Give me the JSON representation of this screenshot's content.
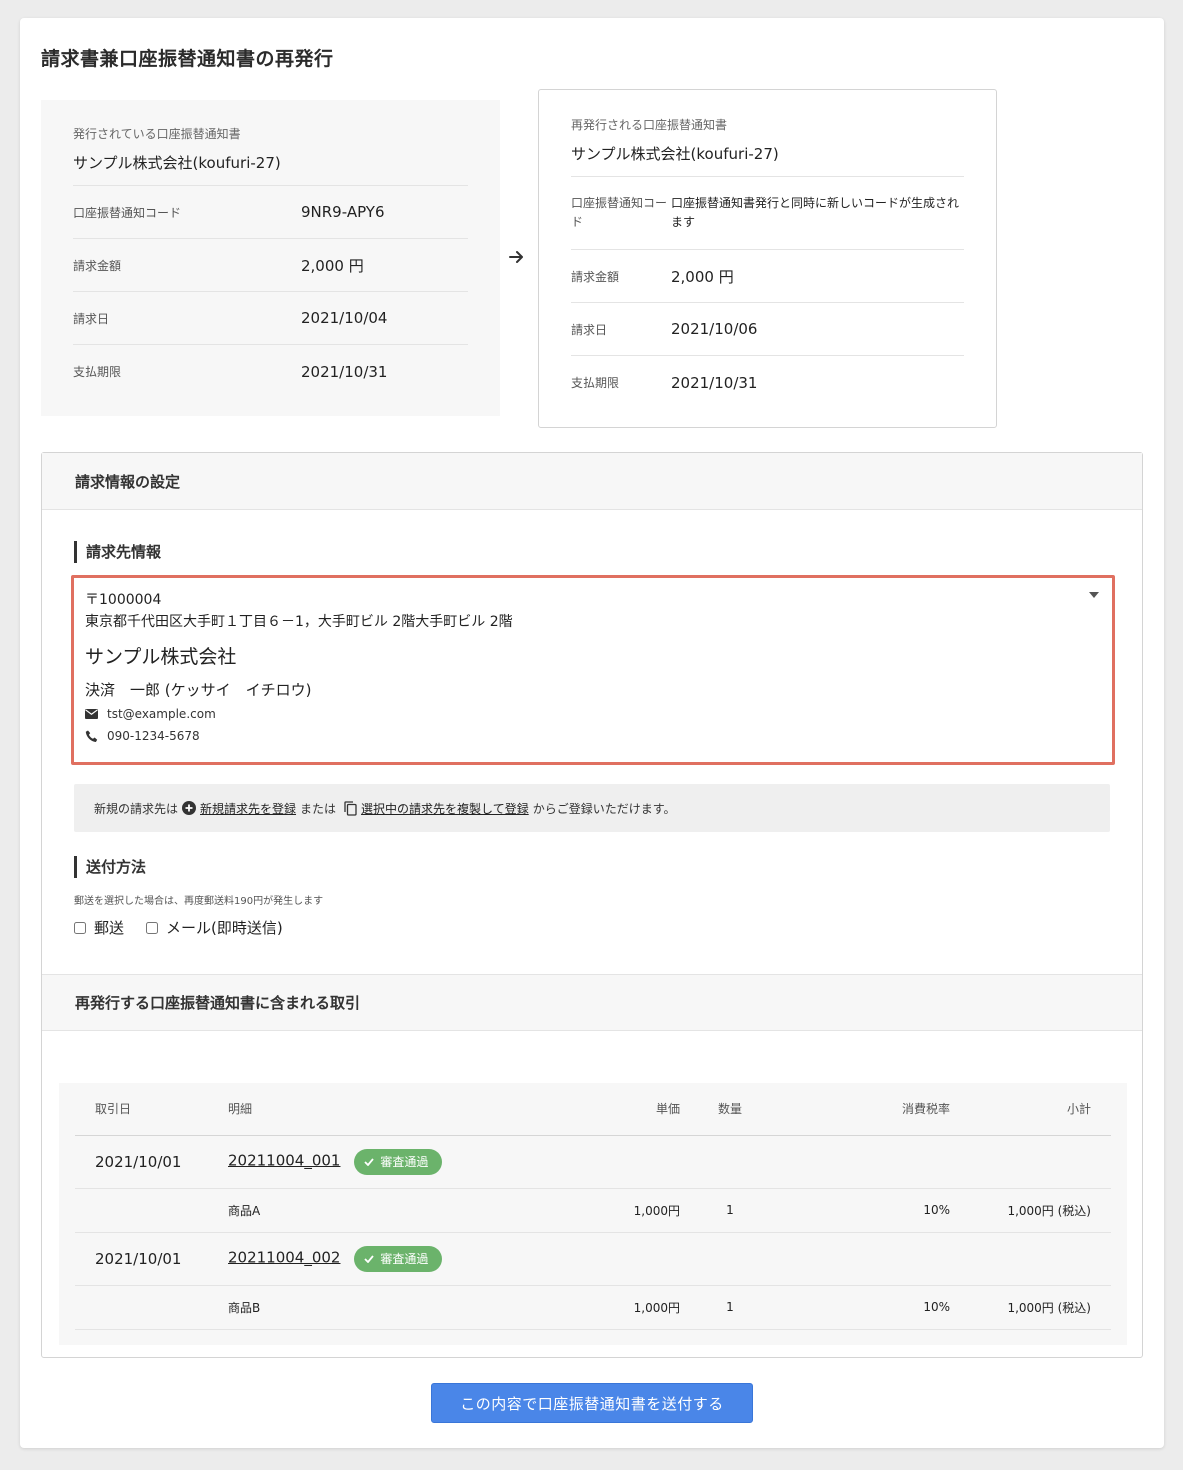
{
  "page": {
    "title": "請求書兼口座振替通知書の再発行"
  },
  "current_notice": {
    "heading": "発行されている口座振替通知書",
    "company": "サンプル株式会社(koufuri-27)",
    "rows": [
      {
        "label": "口座振替通知コード",
        "value": "9NR9-APY6"
      },
      {
        "label": "請求金額",
        "value": "2,000 円"
      },
      {
        "label": "請求日",
        "value": "2021/10/04"
      },
      {
        "label": "支払期限",
        "value": "2021/10/31"
      }
    ]
  },
  "arrow_icon": "arrow-right-icon",
  "reissued_notice": {
    "heading": "再発行される口座振替通知書",
    "company": "サンプル株式会社(koufuri-27)",
    "code_label": "口座振替通知コード",
    "code_value": "口座振替通知書発行と同時に新しいコードが生成されます",
    "rows": [
      {
        "label": "請求金額",
        "value": "2,000 円"
      },
      {
        "label": "請求日",
        "value": "2021/10/06"
      },
      {
        "label": "支払期限",
        "value": "2021/10/31"
      }
    ]
  },
  "billing_settings": {
    "title": "請求情報の設定",
    "recipient": {
      "subtitle": "請求先情報",
      "postal": "〒1000004",
      "address": "東京都千代田区大手町１丁目６－1，大手町ビル 2階大手町ビル 2階",
      "company": "サンプル株式会社",
      "person": "決済　一郎 (ケッサイ　イチロウ)",
      "email": "tst@example.com",
      "phone": "090-1234-5678",
      "icons": {
        "email": "envelope-icon",
        "phone": "phone-icon",
        "dropdown": "caret-down-icon"
      }
    },
    "notice": {
      "prefix": "新規の請求先は",
      "link_new": "新規請求先を登録",
      "middle": "または",
      "link_copy": "選択中の請求先を複製して登録",
      "suffix": "からご登録いただけます。",
      "icons": {
        "new": "plus-circle-icon",
        "copy": "copy-icon"
      }
    },
    "shipping": {
      "subtitle": "送付方法",
      "note": "郵送を選択した場合は、再度郵送料190円が発生します",
      "options": [
        {
          "label": "郵送",
          "checked": false
        },
        {
          "label": "メール(即時送信)",
          "checked": false
        }
      ]
    }
  },
  "transactions": {
    "title": "再発行する口座振替通知書に含まれる取引",
    "columns": [
      "取引日",
      "明細",
      "単価",
      "数量",
      "消費税率",
      "小計"
    ],
    "items": [
      {
        "date": "2021/10/01",
        "id": "20211004_001",
        "badge": "審査通過",
        "line": {
          "name": "商品A",
          "price": "1,000円",
          "qty": "1",
          "tax": "10%",
          "subtotal": "1,000円 (税込)"
        }
      },
      {
        "date": "2021/10/01",
        "id": "20211004_002",
        "badge": "審査通過",
        "line": {
          "name": "商品B",
          "price": "1,000円",
          "qty": "1",
          "tax": "10%",
          "subtotal": "1,000円 (税込)"
        }
      }
    ],
    "badge_icon": "check-icon",
    "badge_color": "#6bb36b"
  },
  "submit": {
    "label": "この内容で口座振替通知書を送付する",
    "color": "#4a86e8"
  },
  "highlight_color": "#e07060"
}
